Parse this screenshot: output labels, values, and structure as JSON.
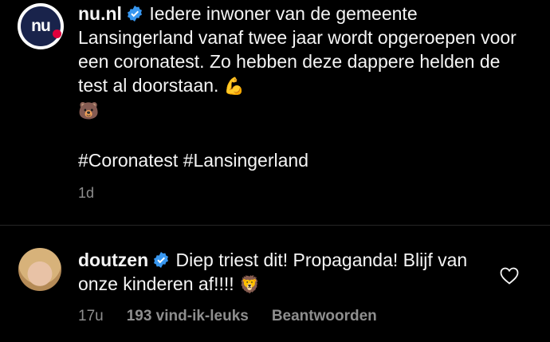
{
  "post": {
    "avatar_text": "nu",
    "username": "nu.nl",
    "caption": "Iedere inwoner van de gemeente Lansingerland vanaf twee jaar wordt opgeroepen voor een coronatest. Zo hebben deze dappere helden de test al doorstaan.",
    "emoji_1": "💪",
    "emoji_2": "🐻",
    "hashtags": "#Coronatest #Lansingerland",
    "time": "1d"
  },
  "comment": {
    "username": "doutzen",
    "text": "Diep triest dit! Propaganda! Blijf van onze kinderen af!!!!",
    "emoji": "🦁",
    "time": "17u",
    "likes": "193 vind-ik-leuks",
    "reply": "Beantwoorden"
  },
  "colors": {
    "background": "#000000",
    "text": "#f5f5f5",
    "muted": "#8e8e8e",
    "verified": "#3897f0",
    "nu_brand": "#19234b"
  }
}
